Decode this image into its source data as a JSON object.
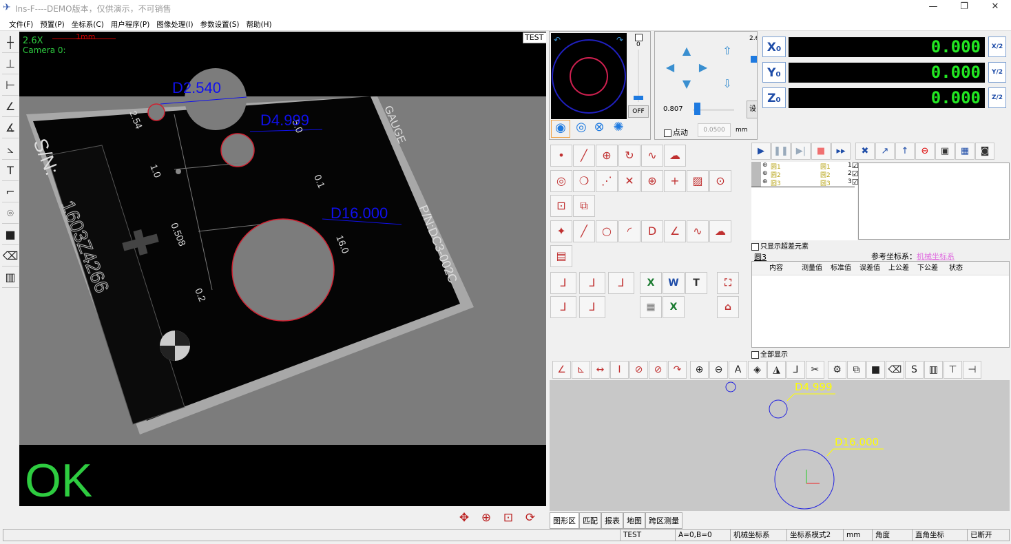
{
  "window": {
    "title": "Ins-F----DEMO版本，仅供演示，不可销售",
    "controls": [
      "minimize",
      "maximize",
      "close"
    ]
  },
  "menu": [
    "文件(F)",
    "预置(P)",
    "坐标系(C)",
    "用户程序(P)",
    "图像处理(I)",
    "参数设置(S)",
    "帮助(H)"
  ],
  "left_tools": [
    {
      "name": "crosshair-icon",
      "glyph": "┼"
    },
    {
      "name": "measure-width-icon",
      "glyph": "⊥"
    },
    {
      "name": "edge-point-icon",
      "glyph": "⊢"
    },
    {
      "name": "angle-icon",
      "glyph": "∠"
    },
    {
      "name": "angle2-icon",
      "glyph": "∡"
    },
    {
      "name": "angle3-icon",
      "glyph": "⦣"
    },
    {
      "name": "text-icon",
      "glyph": "T"
    },
    {
      "name": "corner-icon",
      "glyph": "⌐"
    },
    {
      "name": "focus-icon",
      "glyph": "⌾"
    },
    {
      "name": "record-icon",
      "glyph": "■"
    },
    {
      "name": "clear-icon",
      "glyph": "⌫"
    },
    {
      "name": "barcode-icon",
      "glyph": "▥"
    }
  ],
  "camera": {
    "zoom": "2.6X",
    "scale_label": "1mm",
    "camera_name": "Camera 0:",
    "profile": "TEST",
    "result": "OK",
    "labels": [
      "D2.540",
      "D4.999",
      "D16.000"
    ],
    "gauge_text": {
      "sn": "S/N:",
      "serial": "1603Z4266",
      "pn": "P/N:DC3-002C",
      "gauge": "GAUGE",
      "dims": [
        "2.54",
        "1.0",
        "0.508",
        "0.2",
        "16.0",
        "0.1",
        "5.0"
      ]
    }
  },
  "camera_buttons": [
    {
      "name": "fit-icon",
      "glyph": "✥"
    },
    {
      "name": "zoom-in-icon",
      "glyph": "⊕"
    },
    {
      "name": "zoom-window-icon",
      "glyph": "⊡"
    },
    {
      "name": "refresh-icon",
      "glyph": "⟳"
    }
  ],
  "joystick": {
    "slider_value": "0",
    "light_button": "OFF",
    "modes": [
      "ring-light-icon",
      "dual-ring-icon",
      "segment4-icon",
      "segment8-icon"
    ]
  },
  "jog": {
    "zoom": "2.6",
    "speed": "0.807",
    "inching_label": "点动",
    "step": "0.0500",
    "unit": "mm",
    "set_label": "设"
  },
  "dro": [
    {
      "axis": "X₀",
      "value": "0.000",
      "half": "X/2"
    },
    {
      "axis": "Y₀",
      "value": "0.000",
      "half": "Y/2"
    },
    {
      "axis": "Z₀",
      "value": "0.000",
      "half": "Z/2"
    }
  ],
  "run_toolbar": [
    {
      "name": "run-icon",
      "glyph": "▶",
      "color": "#1f4da8"
    },
    {
      "name": "pause-icon",
      "glyph": "❚❚",
      "color": "#9ab"
    },
    {
      "name": "step-icon",
      "glyph": "▶|",
      "color": "#9ab"
    },
    {
      "name": "stop-icon",
      "glyph": "■",
      "color": "#f07070"
    },
    {
      "name": "fast-forward-icon",
      "glyph": "▸▸",
      "color": "#1f4da8"
    },
    {
      "name": "tools-icon",
      "glyph": "✖",
      "color": "#1f4da8"
    },
    {
      "name": "xyz-icon",
      "glyph": "↗",
      "color": "#1f4da8"
    },
    {
      "name": "z-up-icon",
      "glyph": "↑",
      "color": "#1f4da8"
    },
    {
      "name": "no-entry-icon",
      "glyph": "⊖",
      "color": "#d00"
    },
    {
      "name": "machine-icon",
      "glyph": "▣",
      "color": "#333"
    },
    {
      "name": "grid-icon",
      "glyph": "▦",
      "color": "#1f4da8"
    },
    {
      "name": "camera-snapshot-icon",
      "glyph": "◙",
      "color": "#333"
    }
  ],
  "measure_tools": [
    [
      {
        "name": "point-icon",
        "glyph": "•"
      },
      {
        "name": "line-icon",
        "glyph": "╱"
      },
      {
        "name": "circle-icon",
        "glyph": "⊕"
      },
      {
        "name": "arc-icon",
        "glyph": "↻"
      },
      {
        "name": "curve-icon",
        "glyph": "∿"
      },
      {
        "name": "freeform-icon",
        "glyph": "☁"
      }
    ],
    [
      {
        "name": "concentric-icon",
        "glyph": "◎"
      },
      {
        "name": "ring-icon",
        "glyph": "❍"
      },
      {
        "name": "point-line-icon",
        "glyph": "⋰"
      },
      {
        "name": "intersection-icon",
        "glyph": "✕"
      },
      {
        "name": "zoom-measure-icon",
        "glyph": "⊕"
      },
      {
        "name": "cross-icon",
        "glyph": "+"
      },
      {
        "name": "image-icon",
        "glyph": "▨"
      },
      {
        "name": "target-icon",
        "glyph": "⊙"
      }
    ],
    [
      {
        "name": "box-measure-icon",
        "glyph": "⊡"
      },
      {
        "name": "box-edit-icon",
        "glyph": "⧉"
      }
    ],
    [
      {
        "name": "construct-point-icon",
        "glyph": "✦"
      },
      {
        "name": "construct-line-icon",
        "glyph": "╱"
      },
      {
        "name": "construct-circle-icon",
        "glyph": "○"
      },
      {
        "name": "construct-arc-icon",
        "glyph": "◜"
      },
      {
        "name": "distance-icon",
        "glyph": "D"
      },
      {
        "name": "angle-construct-icon",
        "glyph": "∠"
      },
      {
        "name": "construct-curve-icon",
        "glyph": "∿"
      },
      {
        "name": "construct-freeform-icon",
        "glyph": "☁"
      }
    ],
    [
      {
        "name": "calculator-icon",
        "glyph": "▤"
      }
    ]
  ],
  "coord_tools": [
    {
      "name": "origin-icon",
      "glyph": "⅃"
    },
    {
      "name": "line-align-icon",
      "glyph": "⅃"
    },
    {
      "name": "align-icon",
      "glyph": "⅃"
    },
    {
      "name": "save-coord-icon",
      "glyph": "⅃"
    },
    {
      "name": "coord-3d-icon",
      "glyph": "⅃"
    }
  ],
  "report_tools": [
    {
      "name": "excel-export-icon",
      "glyph": "X"
    },
    {
      "name": "word-export-icon",
      "glyph": "W"
    },
    {
      "name": "txt-export-icon",
      "glyph": "T"
    },
    {
      "name": "print-icon",
      "glyph": "▦"
    },
    {
      "name": "excel-import-icon",
      "glyph": "X"
    },
    {
      "name": "fit-view-icon",
      "glyph": "⛶"
    },
    {
      "name": "home-icon",
      "glyph": "⌂"
    }
  ],
  "element_tree": [
    {
      "a": "圆1",
      "b": "圆1",
      "n": "1"
    },
    {
      "a": "圆2",
      "b": "圆2",
      "n": "2"
    },
    {
      "a": "圆3",
      "b": "圆3",
      "n": "3"
    }
  ],
  "only_out_of_tol": "只显示超差元素",
  "selected_element": "圆3",
  "ref_coord_label": "参考坐标系：",
  "ref_coord_value": "机械坐标系",
  "table_headers": [
    "内容",
    "测量值",
    "标准值",
    "误差值",
    "上公差",
    "下公差",
    "状态"
  ],
  "show_all": "全部显示",
  "graphics_toolbar": [
    {
      "name": "angle-dim-icon",
      "glyph": "∠"
    },
    {
      "name": "perp-icon",
      "glyph": "⊾"
    },
    {
      "name": "width-dim-icon",
      "glyph": "↔"
    },
    {
      "name": "height-dim-icon",
      "glyph": "I"
    },
    {
      "name": "radius-icon",
      "glyph": "⊘"
    },
    {
      "name": "diameter-icon",
      "glyph": "⊘"
    },
    {
      "name": "arc-dim-icon",
      "glyph": "↷"
    },
    {
      "name": "zoom-in-icon",
      "glyph": "⊕"
    },
    {
      "name": "zoom-out-icon",
      "glyph": "⊖"
    },
    {
      "name": "text-icon",
      "glyph": "A"
    },
    {
      "name": "layers-icon",
      "glyph": "◈"
    },
    {
      "name": "label-icon",
      "glyph": "◮"
    },
    {
      "name": "axis-icon",
      "glyph": "⅃"
    },
    {
      "name": "cut-icon",
      "glyph": "✂"
    },
    {
      "name": "settings-icon",
      "glyph": "⚙"
    },
    {
      "name": "link-icon",
      "glyph": "⧉"
    },
    {
      "name": "fill-icon",
      "glyph": "■"
    },
    {
      "name": "eraser-icon",
      "glyph": "⌫"
    },
    {
      "name": "s-icon",
      "glyph": "S"
    },
    {
      "name": "report-icon",
      "glyph": "▥"
    },
    {
      "name": "align-h-icon",
      "glyph": "⊤"
    },
    {
      "name": "align-v-icon",
      "glyph": "⊣"
    }
  ],
  "graphics": {
    "labels": [
      "D4.999",
      "D16.000"
    ]
  },
  "tabs": [
    "图形区",
    "匹配",
    "报表",
    "地图",
    "跨区测量"
  ],
  "status": [
    "TEST",
    "A=0,B=0",
    "机械坐标系",
    "坐标系模式2",
    "mm",
    "角度",
    "直角坐标",
    "已断开"
  ],
  "colors": {
    "dro_text": "#22e822",
    "ok": "#2ecc40",
    "label_blue": "#1010ee",
    "circle_red": "#d02030",
    "graphic_label": "#ffff00"
  }
}
